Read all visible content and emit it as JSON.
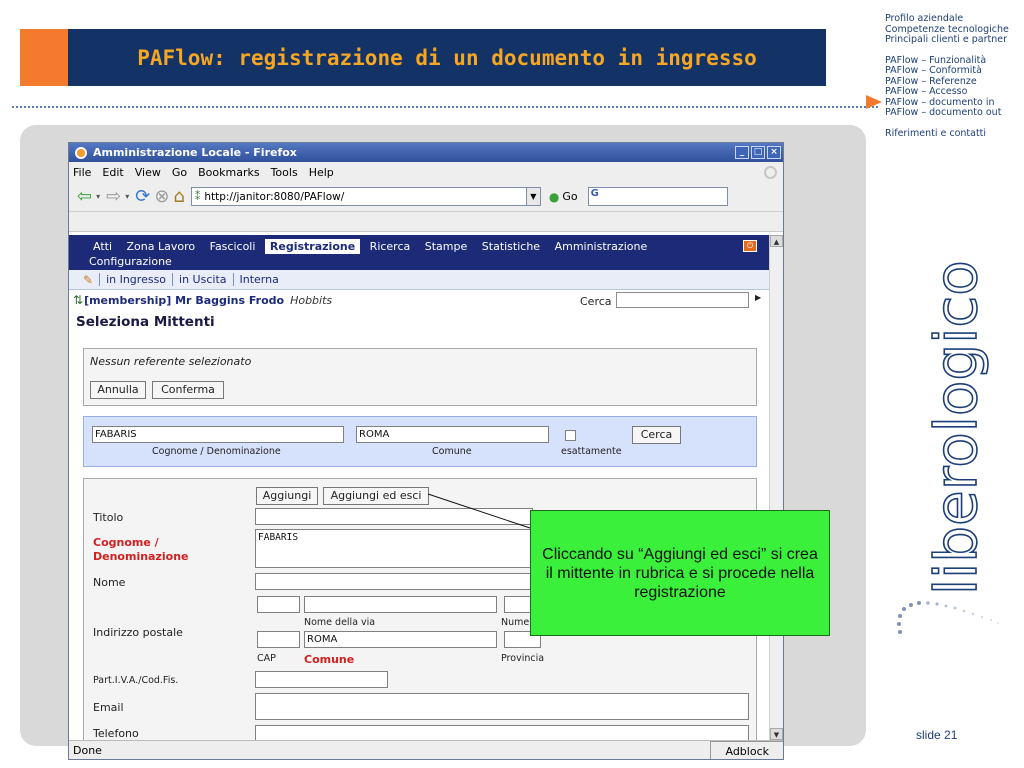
{
  "slide": {
    "title": "PAFlow: registrazione di un documento in ingresso",
    "slide_number": "slide 21",
    "logo_text": "liberologico"
  },
  "nav": {
    "group1": [
      "Profilo aziendale",
      "Competenze tecnologiche",
      "Principali clienti e partner"
    ],
    "group2": [
      "PAFlow – Funzionalità",
      "PAFlow – Conformità",
      "PAFlow – Referenze",
      "PAFlow – Accesso",
      "PAFlow – documento in",
      "PAFlow – documento out"
    ],
    "group3": [
      "Riferimenti e contatti"
    ],
    "current": "PAFlow – documento in"
  },
  "browser": {
    "window_title": "Amministrazione Locale - Firefox",
    "menu": [
      "File",
      "Edit",
      "View",
      "Go",
      "Bookmarks",
      "Tools",
      "Help"
    ],
    "url": "http://janitor:8080/PAFlow/",
    "go_label": "Go",
    "status": "Done",
    "adblock": "Adblock"
  },
  "app": {
    "tabs": [
      "Atti",
      "Zona Lavoro",
      "Fascicoli",
      "Registrazione",
      "Ricerca",
      "Stampe",
      "Statistiche",
      "Amministrazione"
    ],
    "tabs_row2": [
      "Configurazione"
    ],
    "active_tab": "Registrazione",
    "subtabs": [
      "in Ingresso",
      "in Uscita",
      "Interna"
    ],
    "user": "[membership] Mr Baggins Frodo",
    "user_group": "Hobbits",
    "search_label": "Cerca",
    "page_title": "Seleziona Mittenti",
    "selection": {
      "message": "Nessun referente selezionato",
      "annulla": "Annulla",
      "conferma": "Conferma"
    },
    "search": {
      "cognome_value": "FABARIS",
      "cognome_caption": "Cognome / Denominazione",
      "comune_value": "ROMA",
      "comune_caption": "Comune",
      "esattamente_caption": "esattamente",
      "cerca_button": "Cerca"
    },
    "form": {
      "aggiungi": "Aggiungi",
      "aggiungi_esci": "Aggiungi ed esci",
      "titolo": "Titolo",
      "cognome_label_1": "Cognome /",
      "cognome_label_2": "Denominazione",
      "cognome_value": "FABARIS",
      "nome": "Nome",
      "indirizzo": "Indirizzo postale",
      "via_caption": "Nome della via",
      "numero_caption": "Numer",
      "comune_value": "ROMA",
      "cap_caption": "CAP",
      "comune_caption": "Comune",
      "provincia_caption": "Provincia",
      "piva": "Part.I.V.A./Cod.Fis.",
      "email": "Email",
      "telefono": "Telefono"
    }
  },
  "callout": {
    "text": "Cliccando su “Aggiungi ed esci” si crea il mittente in rubrica e si procede nella registrazione"
  },
  "colors": {
    "title_bg": "#133266",
    "title_text": "#f5a623",
    "accent_orange": "#f47a2e",
    "callout_bg": "#3af03a",
    "app_nav_bg": "#1c2a78"
  }
}
